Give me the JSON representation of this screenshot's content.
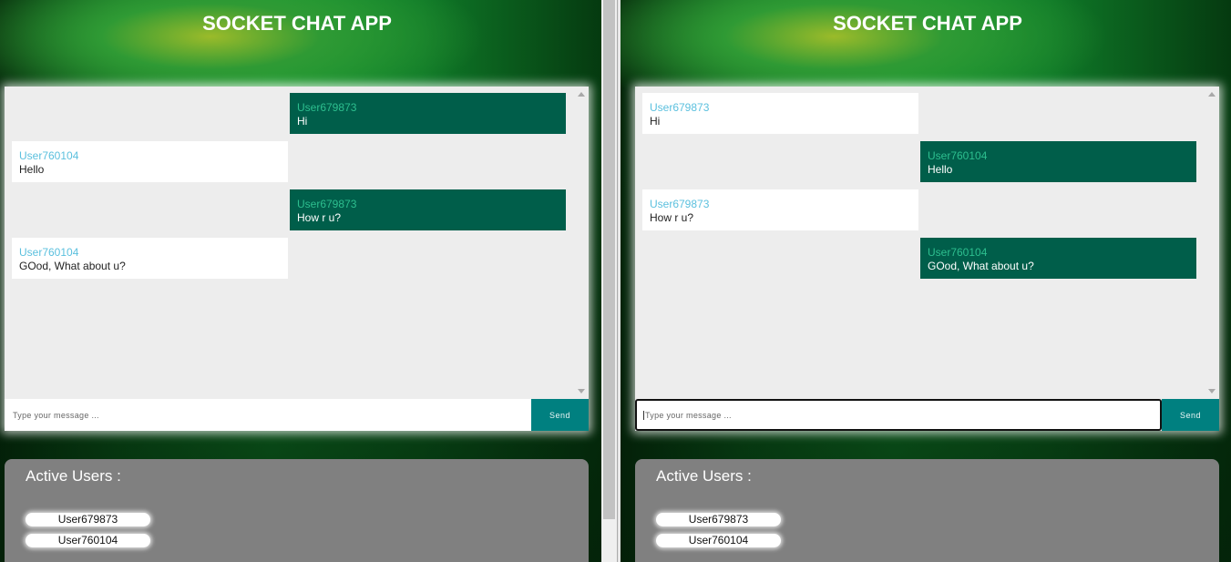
{
  "panes": [
    {
      "title": "SOCKET CHAT APP",
      "input_placeholder": "Type your message ...",
      "send_label": "Send",
      "active_users_title": "Active Users :",
      "active_users": [
        "User679873",
        "User760104"
      ],
      "messages": [
        {
          "user": "User679873",
          "text": "Hi",
          "side": "right"
        },
        {
          "user": "User760104",
          "text": "Hello",
          "side": "left"
        },
        {
          "user": "User679873",
          "text": "How r u?",
          "side": "right"
        },
        {
          "user": "User760104",
          "text": "GOod, What about u?",
          "side": "left"
        }
      ]
    },
    {
      "title": "SOCKET CHAT APP",
      "input_placeholder": "Type your message ...",
      "send_label": "Send",
      "active_users_title": "Active Users :",
      "active_users": [
        "User679873",
        "User760104"
      ],
      "messages": [
        {
          "user": "User679873",
          "text": "Hi",
          "side": "left"
        },
        {
          "user": "User760104",
          "text": "Hello",
          "side": "right"
        },
        {
          "user": "User679873",
          "text": "How r u?",
          "side": "left"
        },
        {
          "user": "User760104",
          "text": "GOod, What about u?",
          "side": "right"
        }
      ]
    }
  ]
}
